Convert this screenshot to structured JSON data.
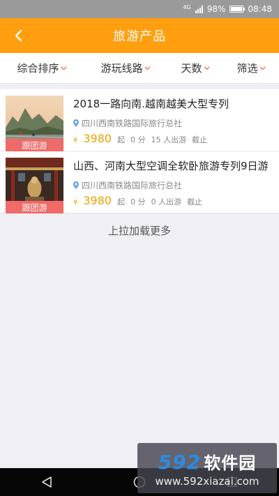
{
  "status_bar": {
    "network": "4G",
    "battery": "98%",
    "time": "08:48"
  },
  "header": {
    "title": "旅游产品",
    "back_icon": "back-arrow-icon"
  },
  "filters": [
    {
      "label": "综合排序"
    },
    {
      "label": "游玩线路"
    },
    {
      "label": "天数"
    },
    {
      "label": "筛选"
    }
  ],
  "products": [
    {
      "title": "2018一路向南.越南越美大型专列",
      "badge": "跟团游",
      "agency": "四川西南铁路国际旅行总社",
      "currency": "¥",
      "price": "3980",
      "price_suffix": "起",
      "score": "0 分",
      "travelers": "15 人出游",
      "deadline": "截止"
    },
    {
      "title": "山西、河南大型空调全软卧旅游专列9日游",
      "badge": "跟团游",
      "agency": "四川西南铁路国际旅行总社",
      "currency": "¥",
      "price": "3980",
      "price_suffix": "起",
      "score": "0 分",
      "travelers": "0 人出游",
      "deadline": "截止"
    }
  ],
  "load_more": "上拉加载更多",
  "watermark": {
    "logo_number": "592",
    "logo_text": "软件园",
    "url": "www.592xiazai.com"
  },
  "colors": {
    "accent": "#ff9f0f",
    "price": "#f0a000",
    "badge": "#f06a6a",
    "chevron": "#f06a3a"
  }
}
